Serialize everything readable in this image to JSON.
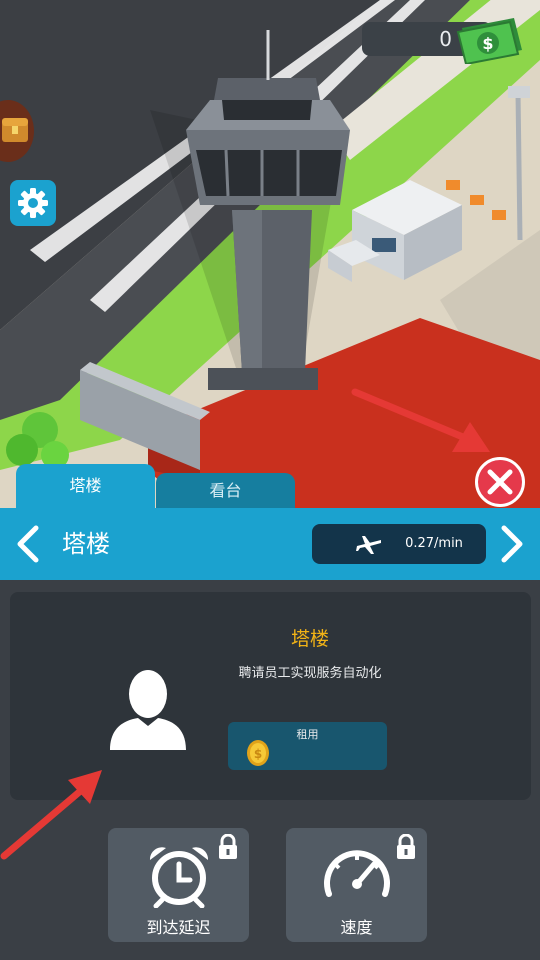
{
  "hud": {
    "money": "0",
    "cash_icon": "dollar-bill-icon",
    "chest_icon": "treasure-chest-icon",
    "settings_icon": "gear-icon"
  },
  "tabs": [
    {
      "label": "塔楼",
      "active": true
    },
    {
      "label": "看台",
      "active": false
    }
  ],
  "header": {
    "title": "塔楼",
    "rate": "0.27/min",
    "rate_icon": "airplane-icon",
    "prev_icon": "chevron-left-icon",
    "next_icon": "chevron-right-icon"
  },
  "staff_card": {
    "title": "塔楼",
    "description": "聘请员工实现服务自动化",
    "hire_label": "租用",
    "hire_icon": "coin-icon",
    "avatar_icon": "person-icon"
  },
  "upgrades": [
    {
      "label": "到达延迟",
      "icon": "alarm-clock-icon",
      "locked": true
    },
    {
      "label": "速度",
      "icon": "speedometer-icon",
      "locked": true
    }
  ],
  "colors": {
    "accent": "#1ba2cf",
    "tab_inactive": "#167e9f",
    "title_gold": "#f2b316",
    "close_red": "#e5394b",
    "panel_bg": "#2e343a"
  }
}
